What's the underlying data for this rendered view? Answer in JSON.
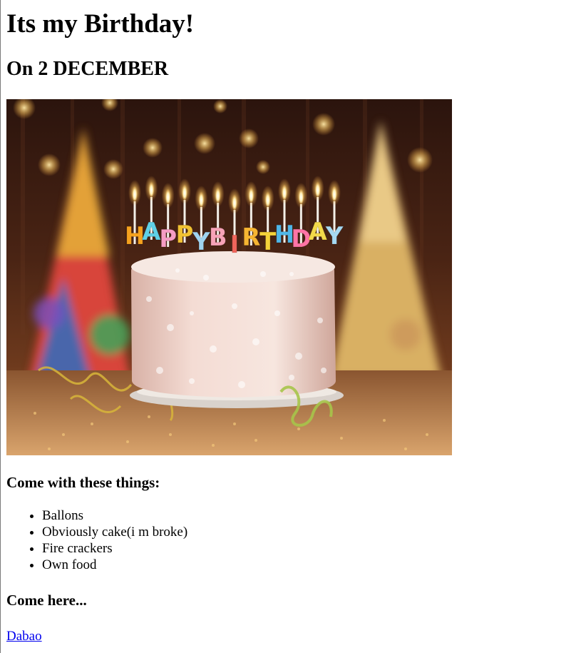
{
  "title": "Its my Birthday!",
  "date_heading": "On 2 DECEMBER",
  "hero_image": {
    "icon": "birthday-cake-photo",
    "alt": "HAPPY BIRTHDAY",
    "candle_letters": [
      "H",
      "A",
      "P",
      "P",
      "Y",
      "B",
      "I",
      "R",
      "T",
      "H",
      "D",
      "A",
      "Y"
    ],
    "candle_colors": [
      "#f6a21e",
      "#5fd0e6",
      "#f59cc4",
      "#f1c232",
      "#9fd3ef",
      "#f7a3b8",
      "#f0655b",
      "#f7b532",
      "#f4d23a",
      "#4fb7e8",
      "#ff74a6",
      "#f2d94a",
      "#a6d9f2"
    ]
  },
  "things_heading": "Come with these things:",
  "things": [
    "Ballons",
    "Obviously cake(i m broke)",
    "Fire crackers",
    "Own food"
  ],
  "come_heading": "Come here...",
  "link_text": "Dabao"
}
